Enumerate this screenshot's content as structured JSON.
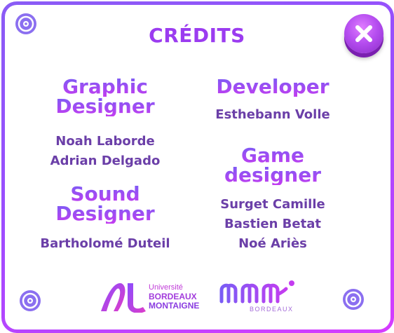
{
  "title": "CRÉDITS",
  "sections": {
    "graphic": {
      "title_1": "Graphic",
      "title_2": "Designer",
      "names": [
        "Noah Laborde",
        "Adrian Delgado"
      ]
    },
    "sound": {
      "title_1": "Sound",
      "title_2": "Designer",
      "names": [
        "Bartholomé Duteil"
      ]
    },
    "developer": {
      "title_1": "Developer",
      "names": [
        "Esthebann Volle"
      ]
    },
    "game": {
      "title_1": "Game",
      "title_2": "designer",
      "names": [
        "Surget Camille",
        "Bastien Betat",
        "Noé Ariès"
      ]
    }
  },
  "logos": {
    "university": {
      "line_1": "Université",
      "line_2": "BORDEAUX",
      "line_3": "MONTAIGNE"
    },
    "mm": {
      "subtitle": "BORDEAUX"
    }
  },
  "colors": {
    "accent": "#9b3cf0",
    "border": "#9b4dff",
    "name_text": "#6b3fa8"
  },
  "icons": {
    "close": "close-x-icon",
    "disc": "disc-icon"
  }
}
